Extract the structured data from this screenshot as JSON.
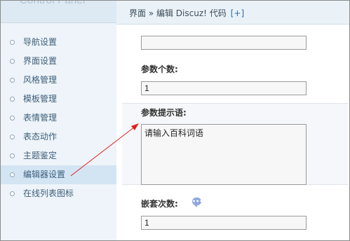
{
  "app": {
    "title": "Control Panel"
  },
  "header": {
    "breadcrumb": "界面 » 编辑 Discuz! 代码",
    "expand_link": "[+]"
  },
  "sidebar": {
    "items": [
      {
        "label": "导航设置"
      },
      {
        "label": "界面设置"
      },
      {
        "label": "风格管理"
      },
      {
        "label": "模板管理"
      },
      {
        "label": "表情管理"
      },
      {
        "label": "表态动作"
      },
      {
        "label": "主题鉴定"
      },
      {
        "label": "编辑器设置",
        "active": true
      },
      {
        "label": "在线列表图标"
      }
    ]
  },
  "form": {
    "top_field_value": "",
    "param_count": {
      "label": "参数个数:",
      "value": "1"
    },
    "param_prompt": {
      "label": "参数提示语:",
      "value": "请输入百科词语"
    },
    "nesting_count": {
      "label": "嵌套次数:",
      "value": "1"
    }
  },
  "colors": {
    "sidebar_bg": "#eef4f9",
    "active_item_bg": "#d3e5f3",
    "annotation_arrow": "#e0201c"
  }
}
